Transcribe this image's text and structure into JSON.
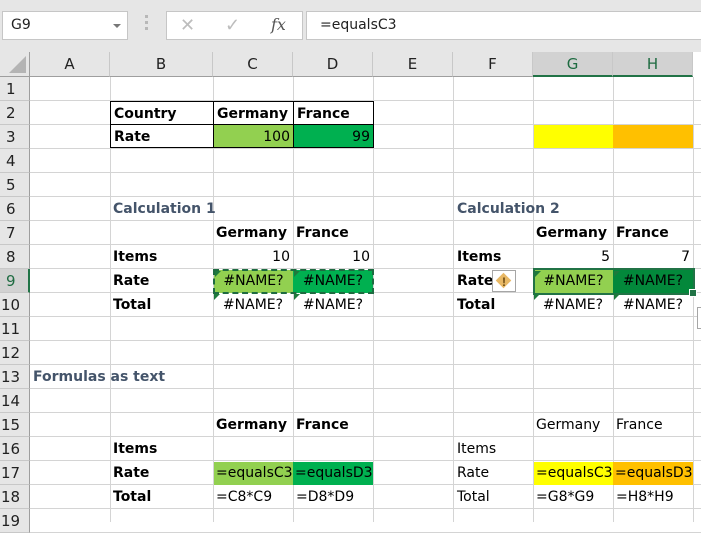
{
  "formula_bar": {
    "name_box": "G9",
    "cancel_icon": "✕",
    "enter_icon": "✓",
    "fx_label": "fx",
    "formula": "=equalsC3"
  },
  "columns": [
    "A",
    "B",
    "C",
    "D",
    "E",
    "F",
    "G",
    "H"
  ],
  "selected_columns": [
    "G",
    "H"
  ],
  "rows": [
    "1",
    "2",
    "3",
    "4",
    "5",
    "6",
    "7",
    "8",
    "9",
    "10",
    "11",
    "12",
    "13",
    "14",
    "15",
    "16",
    "17",
    "18",
    "19"
  ],
  "selected_row": "9",
  "colors": {
    "light_green": "#92d050",
    "dark_green": "#00b050",
    "yellow": "#ffff00",
    "orange": "#ffc000",
    "title_color": "#44546a",
    "selection": "#217346"
  },
  "source_table": {
    "header": [
      "Country",
      "Germany",
      "France"
    ],
    "rate_label": "Rate",
    "rate_values": [
      "100",
      "99"
    ]
  },
  "calc1": {
    "title": "Calculation 1",
    "headers": [
      "Germany",
      "France"
    ],
    "items_label": "Items",
    "items": [
      "10",
      "10"
    ],
    "rate_label": "Rate",
    "rate": [
      "#NAME?",
      "#NAME?"
    ],
    "total_label": "Total",
    "total": [
      "#NAME?",
      "#NAME?"
    ]
  },
  "calc2": {
    "title": "Calculation 2",
    "headers": [
      "Germany",
      "France"
    ],
    "items_label": "Items",
    "items": [
      "5",
      "7"
    ],
    "rate_label": "Rate",
    "warning_icon": "!",
    "rate": [
      "#NAME?",
      "#NAME?"
    ],
    "total_label": "Total",
    "total": [
      "#NAME?",
      "#NAME?"
    ]
  },
  "formulas": {
    "title": "Formulas as text",
    "left": {
      "headers": [
        "Germany",
        "France"
      ],
      "items_label": "Items",
      "rate_label": "Rate",
      "rate": [
        "=equalsC3",
        "=equalsD3"
      ],
      "total_label": "Total",
      "total": [
        "=C8*C9",
        "=D8*D9"
      ]
    },
    "right": {
      "headers": [
        "Germany",
        "France"
      ],
      "items_label": "Items",
      "rate_label": "Rate",
      "rate": [
        "=equalsC3",
        "=equalsD3"
      ],
      "total_label": "Total",
      "total": [
        "=G8*G9",
        "=H8*H9"
      ]
    }
  }
}
